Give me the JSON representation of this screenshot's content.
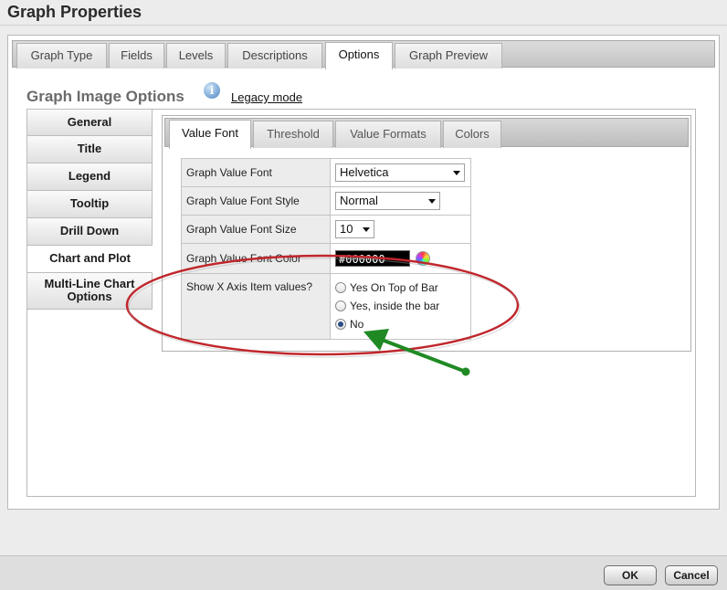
{
  "window": {
    "title": "Graph Properties"
  },
  "top_tabs": [
    {
      "label": "Graph Type"
    },
    {
      "label": "Fields"
    },
    {
      "label": "Levels"
    },
    {
      "label": "Descriptions"
    },
    {
      "label": "Options",
      "active": true
    },
    {
      "label": "Graph Preview"
    }
  ],
  "section": {
    "title": "Graph Image Options",
    "info_icon": "info-icon",
    "legacy_link": "Legacy mode"
  },
  "left_nav": [
    {
      "label": "General"
    },
    {
      "label": "Title"
    },
    {
      "label": "Legend"
    },
    {
      "label": "Tooltip"
    },
    {
      "label": "Drill Down"
    },
    {
      "label": "Chart and Plot",
      "active": true
    },
    {
      "label": "Multi-Line Chart Options"
    }
  ],
  "inner_tabs": [
    {
      "label": "Value Font",
      "active": true
    },
    {
      "label": "Threshold"
    },
    {
      "label": "Value Formats"
    },
    {
      "label": "Colors"
    }
  ],
  "form": {
    "font": {
      "label": "Graph Value Font",
      "value": "Helvetica"
    },
    "style": {
      "label": "Graph Value Font Style",
      "value": "Normal"
    },
    "size": {
      "label": "Graph Value Font Size",
      "value": "10"
    },
    "color": {
      "label": "Graph Value Font Color",
      "value": "#000000"
    },
    "show_x_axis": {
      "label": "Show X Axis Item values?",
      "options": [
        "Yes On Top of Bar",
        "Yes, inside the bar",
        "No"
      ],
      "selected": "No"
    }
  },
  "annotation": {
    "ellipse_color": "#c0272d",
    "arrow_color": "#1f8a24"
  },
  "buttons": {
    "ok": "OK",
    "cancel": "Cancel"
  }
}
